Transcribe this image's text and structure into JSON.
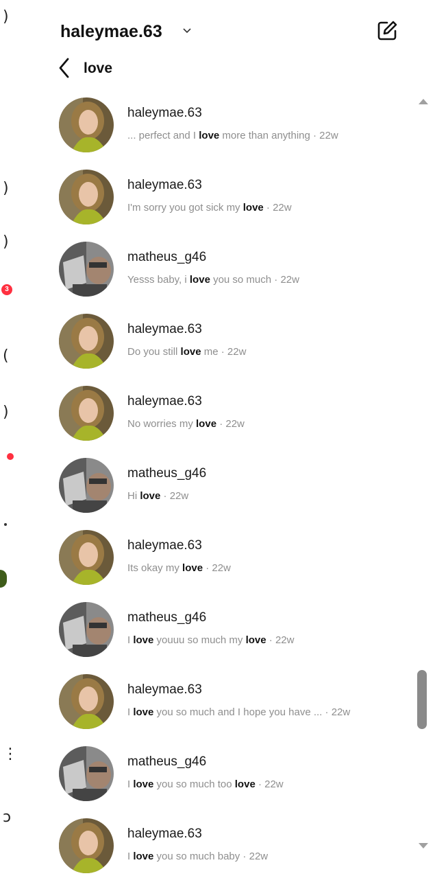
{
  "header": {
    "account_name": "haleymae.63",
    "compose_icon": "compose-icon",
    "chevron_icon": "chevron-down-icon"
  },
  "search": {
    "term": "love",
    "back_icon": "back-arrow-icon"
  },
  "results": [
    {
      "username": "haleymae.63",
      "avatar": "haley",
      "before": "... perfect and I ",
      "match": "love",
      "after": " more than anything",
      "time": " · 22w"
    },
    {
      "username": "haleymae.63",
      "avatar": "haley",
      "before": "I'm sorry you got sick my ",
      "match": "love",
      "after": "",
      "time": " · 22w"
    },
    {
      "username": "matheus_g46",
      "avatar": "matheus",
      "before": "Yesss baby, i ",
      "match": "love",
      "after": " you so much",
      "time": " · 22w"
    },
    {
      "username": "haleymae.63",
      "avatar": "haley",
      "before": "Do you still ",
      "match": "love",
      "after": " me",
      "time": " · 22w"
    },
    {
      "username": "haleymae.63",
      "avatar": "haley",
      "before": "No worries my ",
      "match": "love",
      "after": "",
      "time": " · 22w"
    },
    {
      "username": "matheus_g46",
      "avatar": "matheus",
      "before": "Hi ",
      "match": "love",
      "after": "",
      "time": " · 22w"
    },
    {
      "username": "haleymae.63",
      "avatar": "haley",
      "before": "Its okay my ",
      "match": "love",
      "after": "",
      "time": " · 22w"
    },
    {
      "username": "matheus_g46",
      "avatar": "matheus",
      "before": "I ",
      "match": "love",
      "after": " youuu so much my ",
      "match2": "love",
      "time": " · 22w"
    },
    {
      "username": "haleymae.63",
      "avatar": "haley",
      "before": "I ",
      "match": "love",
      "after": " you so much and I hope you have ...",
      "time": "  · 22w"
    },
    {
      "username": "matheus_g46",
      "avatar": "matheus",
      "before": "I ",
      "match": "love",
      "after": " you so much too ",
      "match2": "love",
      "time": " · 22w"
    },
    {
      "username": "haleymae.63",
      "avatar": "haley",
      "before": "I ",
      "match": "love",
      "after": " you so much baby",
      "time": " · 22w"
    }
  ],
  "left_rail": {
    "badge_count": "3"
  },
  "colors": {
    "accent_red": "#ff3040",
    "snippet_grey": "#8e8e8e"
  }
}
